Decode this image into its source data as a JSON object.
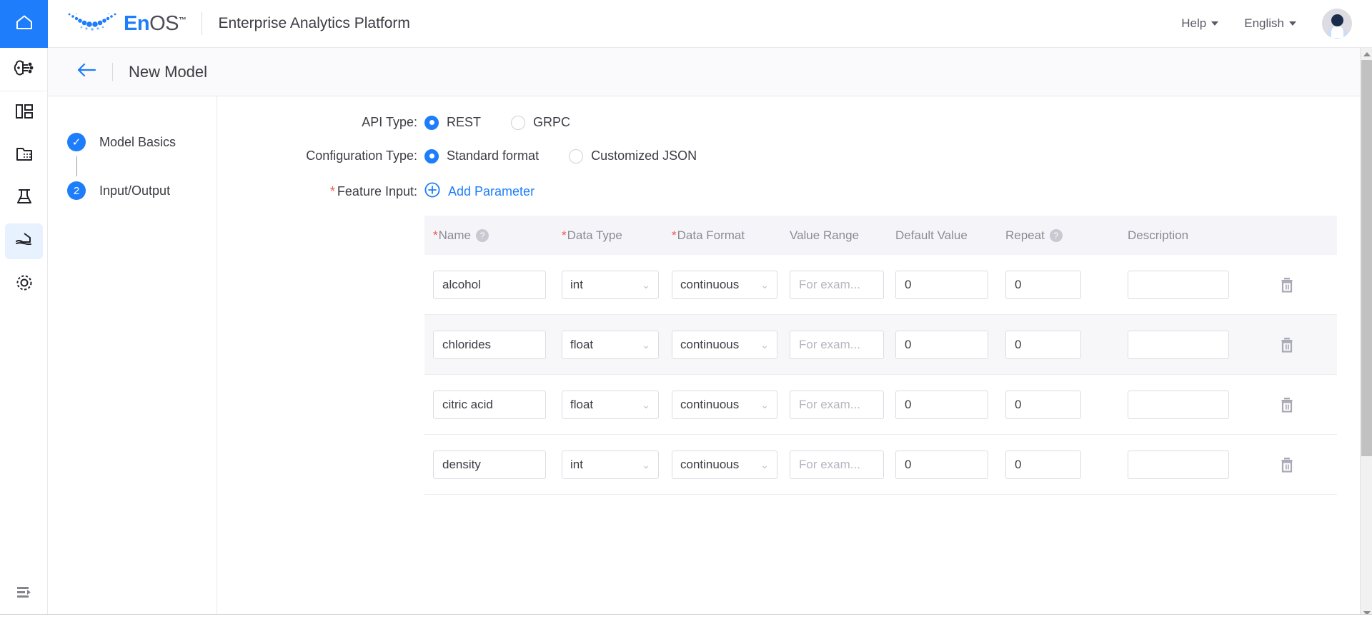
{
  "topbar": {
    "home_icon": "home-icon",
    "brand_en": "En",
    "brand_os": "OS",
    "brand_tm": "™",
    "platform_title": "Enterprise Analytics Platform",
    "help_label": "Help",
    "language_label": "English",
    "avatar": "user-avatar"
  },
  "rail": {
    "items": [
      {
        "icon": "ai-model-icon",
        "active": false
      },
      {
        "icon": "dashboard-layout-icon",
        "active": false
      },
      {
        "icon": "data-folder-icon",
        "active": false
      },
      {
        "icon": "lab-flask-icon",
        "active": false
      },
      {
        "icon": "model-serving-icon",
        "active": true
      },
      {
        "icon": "settings-gear-icon",
        "active": false
      }
    ],
    "collapse_icon": "collapse-sidebar-icon"
  },
  "page_header": {
    "back_icon": "back-arrow-icon",
    "title": "New Model"
  },
  "steps": [
    {
      "marker": "✓",
      "label": "Model Basics",
      "state": "completed"
    },
    {
      "marker": "2",
      "label": "Input/Output",
      "state": "active"
    }
  ],
  "form": {
    "api_type": {
      "label": "API Type:",
      "options": [
        {
          "label": "REST",
          "checked": true
        },
        {
          "label": "GRPC",
          "checked": false
        }
      ]
    },
    "configuration_type": {
      "label": "Configuration Type:",
      "options": [
        {
          "label": "Standard format",
          "checked": true
        },
        {
          "label": "Customized JSON",
          "checked": false
        }
      ]
    },
    "feature_input": {
      "label": "Feature Input:",
      "required": true,
      "add_parameter_label": "Add Parameter",
      "add_icon": "plus-circle-icon"
    }
  },
  "table": {
    "headers": [
      {
        "label": "Name",
        "required": true,
        "help": true
      },
      {
        "label": "Data Type",
        "required": true,
        "help": false
      },
      {
        "label": "Data Format",
        "required": true,
        "help": false
      },
      {
        "label": "Value Range",
        "required": false,
        "help": false
      },
      {
        "label": "Default Value",
        "required": false,
        "help": false
      },
      {
        "label": "Repeat",
        "required": false,
        "help": true
      },
      {
        "label": "Description",
        "required": false,
        "help": false
      }
    ],
    "value_range_placeholder": "For exam...",
    "delete_icon": "trash-icon",
    "rows": [
      {
        "name": "alcohol",
        "data_type": "int",
        "data_format": "continuous",
        "value_range": "",
        "default_value": "0",
        "repeat": "0",
        "description": ""
      },
      {
        "name": "chlorides",
        "data_type": "float",
        "data_format": "continuous",
        "value_range": "",
        "default_value": "0",
        "repeat": "0",
        "description": ""
      },
      {
        "name": "citric acid",
        "data_type": "float",
        "data_format": "continuous",
        "value_range": "",
        "default_value": "0",
        "repeat": "0",
        "description": ""
      },
      {
        "name": "density",
        "data_type": "int",
        "data_format": "continuous",
        "value_range": "",
        "default_value": "0",
        "repeat": "0",
        "description": ""
      }
    ]
  },
  "colors": {
    "accent": "#1d7dfa",
    "required": "#f5534c",
    "header_bg": "#f5f5f9",
    "alt_row": "#f7f7fa"
  }
}
